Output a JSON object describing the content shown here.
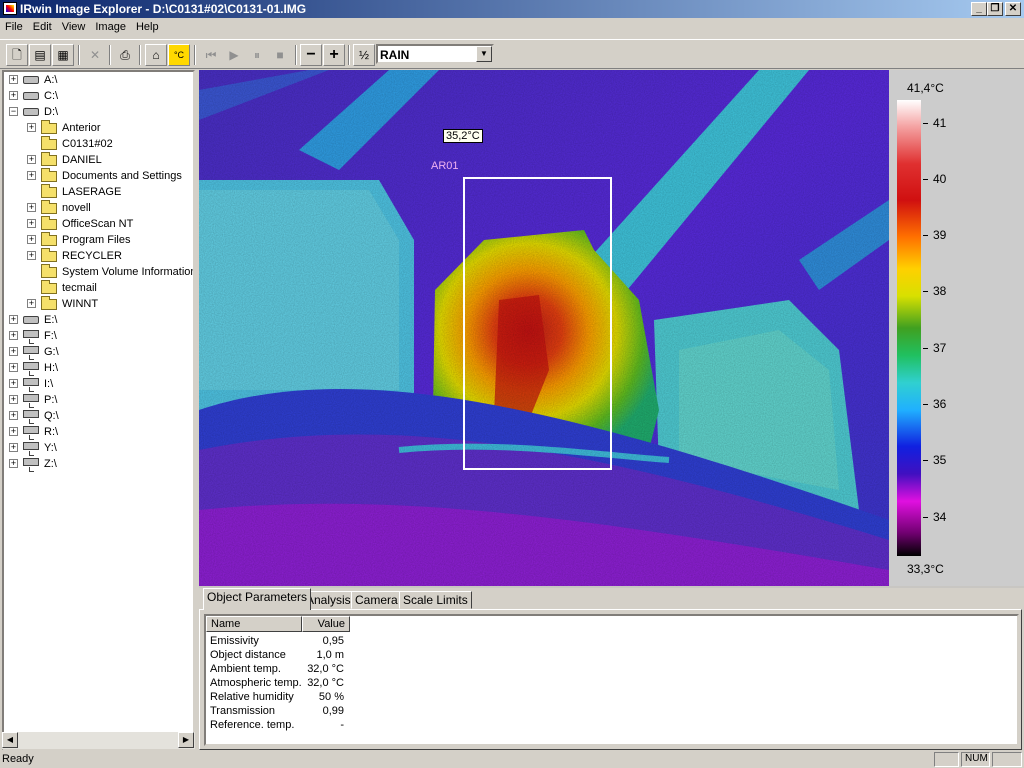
{
  "window": {
    "title": "IRwin Image Explorer - D:\\C0131#02\\C0131-01.IMG"
  },
  "menu": [
    "File",
    "Edit",
    "View",
    "Image",
    "Help"
  ],
  "toolbar": {
    "zoom_out": "−",
    "zoom_in": "+",
    "half": "½",
    "palette": "RAIN"
  },
  "tree": {
    "drives": [
      {
        "label": "A:\\",
        "type": "drive"
      },
      {
        "label": "C:\\",
        "type": "drive"
      },
      {
        "label": "D:\\",
        "type": "drive",
        "expanded": true
      },
      {
        "label": "E:\\",
        "type": "cd"
      },
      {
        "label": "F:\\",
        "type": "net"
      },
      {
        "label": "G:\\",
        "type": "net"
      },
      {
        "label": "H:\\",
        "type": "net"
      },
      {
        "label": "I:\\",
        "type": "net"
      },
      {
        "label": "P:\\",
        "type": "net"
      },
      {
        "label": "Q:\\",
        "type": "net"
      },
      {
        "label": "R:\\",
        "type": "net"
      },
      {
        "label": "Y:\\",
        "type": "net"
      },
      {
        "label": "Z:\\",
        "type": "net"
      }
    ],
    "d_children": [
      {
        "label": "Anterior",
        "expandable": true
      },
      {
        "label": "C0131#02",
        "expandable": false,
        "open": true
      },
      {
        "label": "DANIEL",
        "expandable": true
      },
      {
        "label": "Documents and Settings",
        "expandable": true
      },
      {
        "label": "LASERAGE",
        "expandable": false
      },
      {
        "label": "novell",
        "expandable": true
      },
      {
        "label": "OfficeScan NT",
        "expandable": true
      },
      {
        "label": "Program Files",
        "expandable": true
      },
      {
        "label": "RECYCLER",
        "expandable": true
      },
      {
        "label": "System Volume Information",
        "expandable": false
      },
      {
        "label": "tecmail",
        "expandable": false
      },
      {
        "label": "WINNT",
        "expandable": true
      }
    ]
  },
  "image": {
    "spot_label": "35,2°C",
    "area_label": "AR01"
  },
  "scale": {
    "max_label": "41,4°C",
    "min_label": "33,3°C",
    "min_value": 33.3,
    "max_value": 41.4,
    "ticks": [
      "41",
      "40",
      "39",
      "38",
      "37",
      "36",
      "35",
      "34"
    ]
  },
  "tabs": [
    {
      "label": "Object Parameters",
      "active": true
    },
    {
      "label": "Analysis"
    },
    {
      "label": "Camera"
    },
    {
      "label": "Scale Limits"
    }
  ],
  "params": {
    "headers": [
      "Name",
      "Value"
    ],
    "rows": [
      [
        "Emissivity",
        "0,95"
      ],
      [
        "Object distance",
        "1,0 m"
      ],
      [
        "Ambient temp.",
        "32,0 °C"
      ],
      [
        "Atmospheric temp.",
        "32,0 °C"
      ],
      [
        "Relative humidity",
        "50 %"
      ],
      [
        "Transmission",
        "0,99"
      ],
      [
        "Reference. temp.",
        "-"
      ]
    ]
  },
  "status": {
    "text": "Ready",
    "num": "NUM"
  }
}
